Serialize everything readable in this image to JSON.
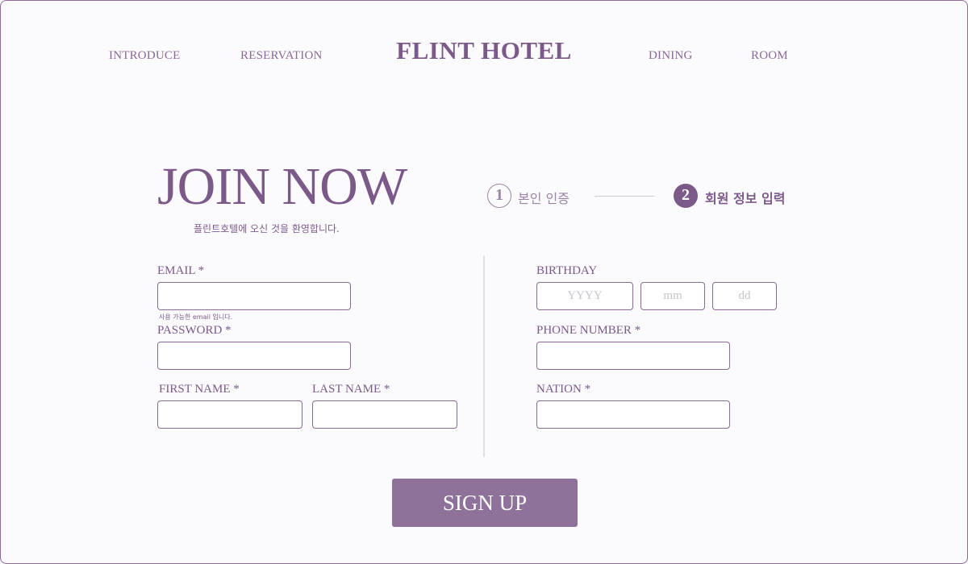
{
  "header": {
    "brand": "FLINT HOTEL",
    "nav": {
      "introduce": "INTRODUCE",
      "reservation": "RESERVATION",
      "dining": "DINING",
      "room": "ROOM"
    }
  },
  "join": {
    "title": "JOIN NOW",
    "subtitle": "플린트호텔에 오신 것을  환영합니다."
  },
  "steps": [
    {
      "number": "1",
      "label": "본인 인증",
      "active": false
    },
    {
      "number": "2",
      "label": "회원 정보 입력",
      "active": true
    }
  ],
  "form": {
    "email": {
      "label": "EMAIL *",
      "value": "",
      "hint": "사용 가능한 email 입니다."
    },
    "password": {
      "label": "PASSWORD *",
      "value": ""
    },
    "first_name": {
      "label": "FIRST NAME *",
      "value": ""
    },
    "last_name": {
      "label": "LAST NAME *",
      "value": ""
    },
    "birthday": {
      "label": "BIRTHDAY",
      "year_placeholder": "YYYY",
      "month_placeholder": "mm",
      "day_placeholder": "dd"
    },
    "phone": {
      "label": "PHONE NUMBER *",
      "value": ""
    },
    "nation": {
      "label": "NATION *",
      "value": ""
    },
    "submit_label": "SIGN UP"
  },
  "colors": {
    "accent": "#7b5a8a",
    "button": "#8e7299",
    "background": "#fbfafd",
    "inactive": "#9a86a4"
  }
}
